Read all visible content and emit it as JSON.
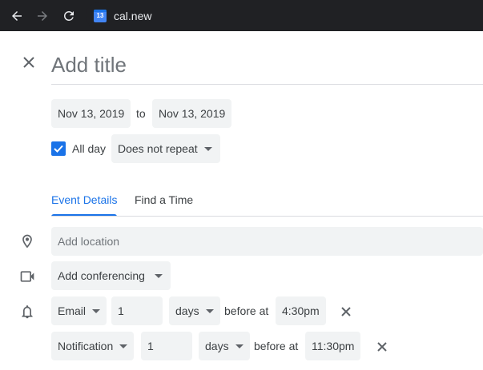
{
  "browser": {
    "url": "cal.new",
    "favicon_text": "13",
    "icons": [
      "back-arrow-icon",
      "forward-arrow-icon",
      "reload-icon"
    ]
  },
  "event": {
    "title_placeholder": "Add title",
    "start_date": "Nov 13, 2019",
    "to_label": "to",
    "end_date": "Nov 13, 2019",
    "all_day_label": "All day",
    "all_day_checked": true,
    "repeat": "Does not repeat"
  },
  "tabs": [
    {
      "label": "Event Details",
      "active": true
    },
    {
      "label": "Find a Time",
      "active": false
    }
  ],
  "details": {
    "location_placeholder": "Add location",
    "conferencing": "Add conferencing"
  },
  "notifications": [
    {
      "type": "Email",
      "amount": "1",
      "unit": "days",
      "before_label": "before at",
      "time": "4:30pm"
    },
    {
      "type": "Notification",
      "amount": "1",
      "unit": "days",
      "before_label": "before at",
      "time": "11:30pm"
    }
  ],
  "colors": {
    "accent": "#1a73e8",
    "chrome_bg": "#202124",
    "field_bg": "#f1f3f4"
  }
}
